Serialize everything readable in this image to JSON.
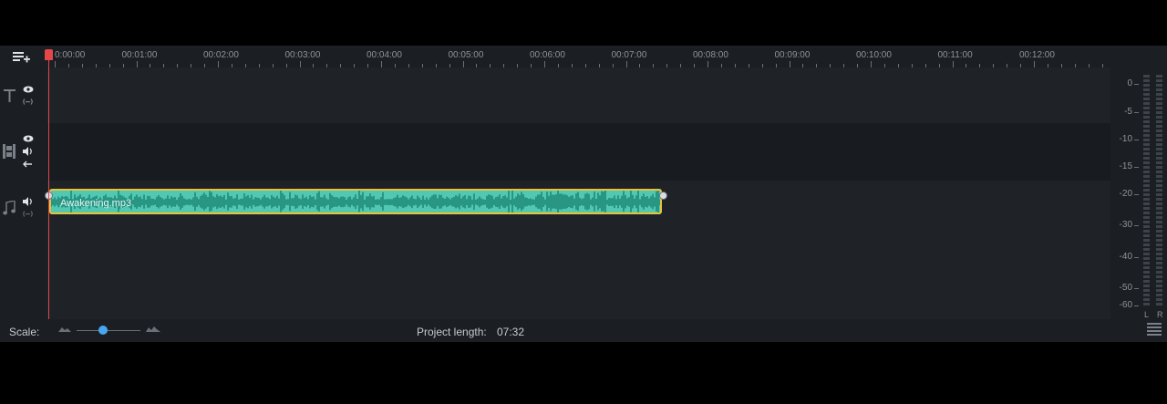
{
  "timeline": {
    "ruler_labels": [
      "0:00:00",
      "00:01:00",
      "00:02:00",
      "00:03:00",
      "00:04:00",
      "00:05:00",
      "00:06:00",
      "00:07:00",
      "00:08:00",
      "00:09:00",
      "00:10:00",
      "00:11:00",
      "00:12:00"
    ],
    "clip": {
      "name": "Awakening.mp3",
      "fill_color": "#52c8b3",
      "border_color": "#e9c23a"
    }
  },
  "left_icons": {
    "add_track": "add-track-icon",
    "text_track": "text-track-icon",
    "video_track": "film-strip-icon",
    "audio_track": "music-note-icon"
  },
  "meter": {
    "labels": [
      "0",
      "-5",
      "-10",
      "-15",
      "-20",
      "-30",
      "-40",
      "-50",
      "-60"
    ],
    "left": "L",
    "right": "R"
  },
  "bottom_bar": {
    "scale_label": "Scale:",
    "project_length_label": "Project length:",
    "project_length_value": "07:32"
  }
}
